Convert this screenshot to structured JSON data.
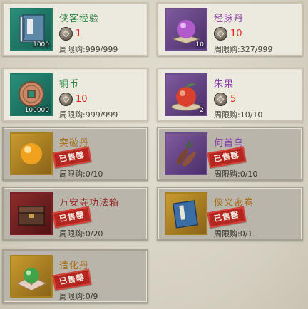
{
  "currency_icon": "copper-coin-icon",
  "sold_stamp_label": "已售罄",
  "items": [
    {
      "name": "侠客经验",
      "name_color": "#2f8a4a",
      "qty": "1000",
      "price": "1",
      "limit": "周限购:999/999",
      "sold": false,
      "icon": "manual-book-icon"
    },
    {
      "name": "经脉丹",
      "name_color": "#8d3fa8",
      "qty": "10",
      "price": "10",
      "limit": "周限购:327/999",
      "sold": false,
      "icon": "purple-pill-icon"
    },
    {
      "name": "铜币",
      "name_color": "#2f8a4a",
      "qty": "100000",
      "price": "10",
      "limit": "周限购:999/999",
      "sold": false,
      "icon": "copper-coin-item-icon"
    },
    {
      "name": "朱果",
      "name_color": "#8d3fa8",
      "qty": "2",
      "price": "5",
      "limit": "周限购:10/10",
      "sold": false,
      "icon": "red-fruit-icon"
    },
    {
      "name": "突破丹",
      "name_color": "#a86a12",
      "qty": "",
      "price": "",
      "limit": "周限购:0/10",
      "sold": true,
      "icon": "orange-pill-icon"
    },
    {
      "name": "何首乌",
      "name_color": "#8d3fa8",
      "qty": "",
      "price": "",
      "limit": "周限购:0/10",
      "sold": true,
      "icon": "root-herb-icon"
    },
    {
      "name": "万安寺功法箱",
      "name_color": "#9a2a2a",
      "qty": "",
      "price": "",
      "limit": "周限购:0/20",
      "sold": true,
      "icon": "treasure-chest-icon"
    },
    {
      "name": "侠义密卷",
      "name_color": "#a86a12",
      "qty": "",
      "price": "",
      "limit": "周限购:0/1",
      "sold": true,
      "icon": "blue-scroll-icon"
    },
    {
      "name": "造化丹",
      "name_color": "#a86a12",
      "qty": "",
      "price": "",
      "limit": "周限购:0/9",
      "sold": true,
      "icon": "green-pill-icon"
    }
  ]
}
